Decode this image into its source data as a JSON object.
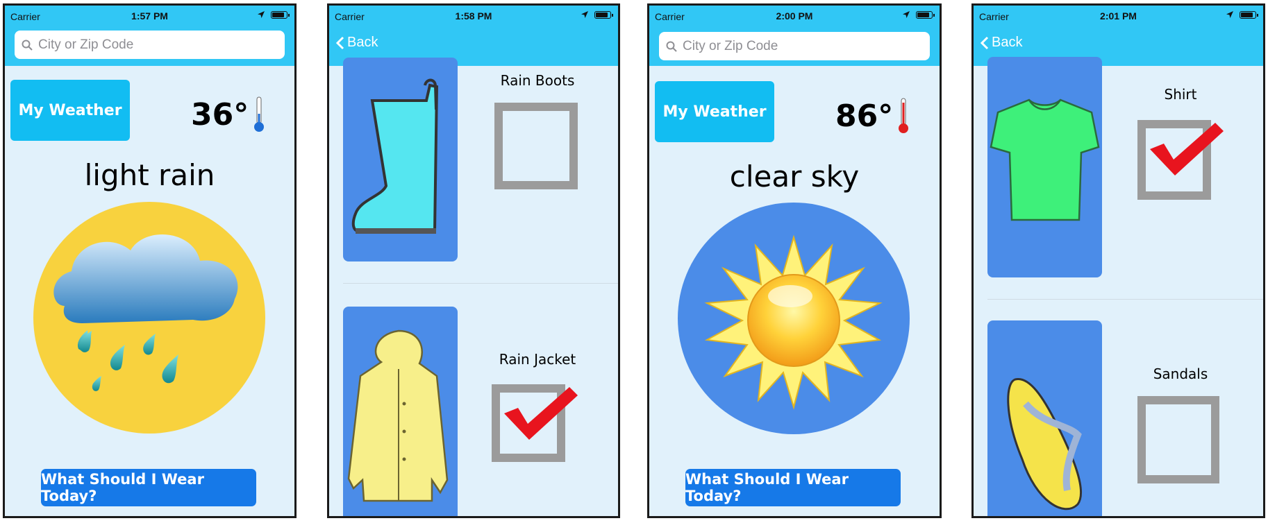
{
  "status": {
    "carrier": "Carrier",
    "times": [
      "1:57 PM",
      "1:58 PM",
      "2:00 PM",
      "2:01 PM"
    ]
  },
  "search": {
    "placeholder": "City or Zip Code"
  },
  "nav": {
    "back_label": "Back"
  },
  "screen1": {
    "my_weather_label": "My Weather",
    "temperature": "36°",
    "condition": "light rain",
    "wear_button": "What Should I Wear Today?",
    "thermometer_color": "#1f6fd6",
    "circle_color": "#f8d23e"
  },
  "screen2": {
    "items": [
      {
        "label": "Rain Boots",
        "checked": false,
        "icon": "rain-boot-icon"
      },
      {
        "label": "Rain Jacket",
        "checked": true,
        "icon": "rain-jacket-icon"
      }
    ]
  },
  "screen3": {
    "my_weather_label": "My Weather",
    "temperature": "86°",
    "condition": "clear sky",
    "wear_button": "What Should I Wear Today?",
    "thermometer_color": "#e02020",
    "circle_color": "#4b8ce8"
  },
  "screen4": {
    "items": [
      {
        "label": "Shirt",
        "checked": true,
        "icon": "shirt-icon"
      },
      {
        "label": "Sandals",
        "checked": false,
        "icon": "sandal-icon"
      }
    ]
  },
  "colors": {
    "bar": "#31c7f5",
    "background": "#e1f1fb",
    "card": "#4b8ce8",
    "button": "#1679e8",
    "check": "#e8141e"
  }
}
